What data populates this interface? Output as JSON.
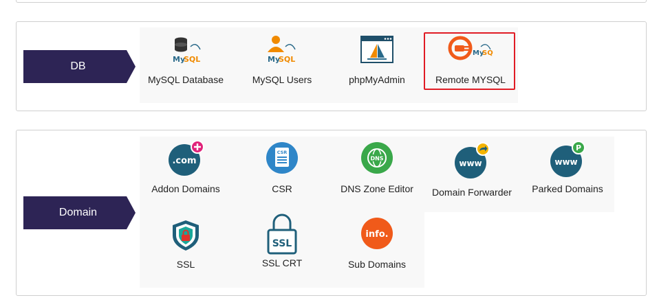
{
  "db": {
    "label": "DB",
    "items": [
      {
        "label": "MySQL Database",
        "icon": "mysql-database-icon"
      },
      {
        "label": "MySQL Users",
        "icon": "mysql-users-icon"
      },
      {
        "label": "phpMyAdmin",
        "icon": "phpmyadmin-icon"
      },
      {
        "label": "Remote MYSQL",
        "icon": "remote-mysql-icon"
      }
    ]
  },
  "domain": {
    "label": "Domain",
    "items": [
      {
        "label": "Addon Domains",
        "icon": "addon-domains-icon",
        "icon_text": ".com"
      },
      {
        "label": "CSR",
        "icon": "csr-icon",
        "icon_text": "CSR"
      },
      {
        "label": "DNS Zone Editor",
        "icon": "dns-zone-editor-icon",
        "icon_text": "DNS"
      },
      {
        "label": "Domain Forwarder",
        "icon": "domain-forwarder-icon",
        "icon_text": "www"
      },
      {
        "label": "Parked Domains",
        "icon": "parked-domains-icon",
        "icon_text": "www"
      },
      {
        "label": "SSL",
        "icon": "ssl-shield-icon"
      },
      {
        "label": "SSL CRT",
        "icon": "ssl-crt-icon",
        "icon_text": "SSL"
      },
      {
        "label": "Sub Domains",
        "icon": "sub-domains-icon",
        "icon_text": "info."
      }
    ]
  },
  "colors": {
    "ribbon": "#2d2455",
    "highlight": "#e01b24",
    "teal": "#1f5f7a",
    "blue": "#2f86c8",
    "green": "#3aa84a",
    "orange": "#f05a1a",
    "magenta": "#e0237a"
  }
}
